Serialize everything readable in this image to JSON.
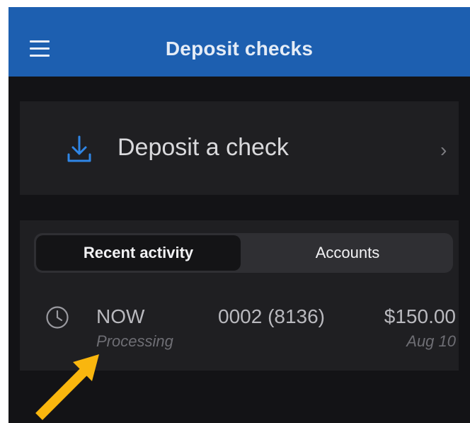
{
  "header": {
    "title": "Deposit checks",
    "menu_icon": "hamburger-menu-icon",
    "bg_color": "#1d5fb0"
  },
  "deposit": {
    "label": "Deposit a check",
    "icon": "download-tray-icon",
    "chevron": "›"
  },
  "tabs": [
    {
      "label": "Recent activity",
      "selected": true
    },
    {
      "label": "Accounts",
      "selected": false
    }
  ],
  "transactions": [
    {
      "status": "NOW",
      "substatus": "Processing",
      "account": "0002 (8136)",
      "amount": "$150.00",
      "date": "Aug 10",
      "icon": "clock-icon"
    }
  ],
  "annotation": {
    "icon": "arrow-annotation-icon",
    "color": "#f9b60e"
  }
}
